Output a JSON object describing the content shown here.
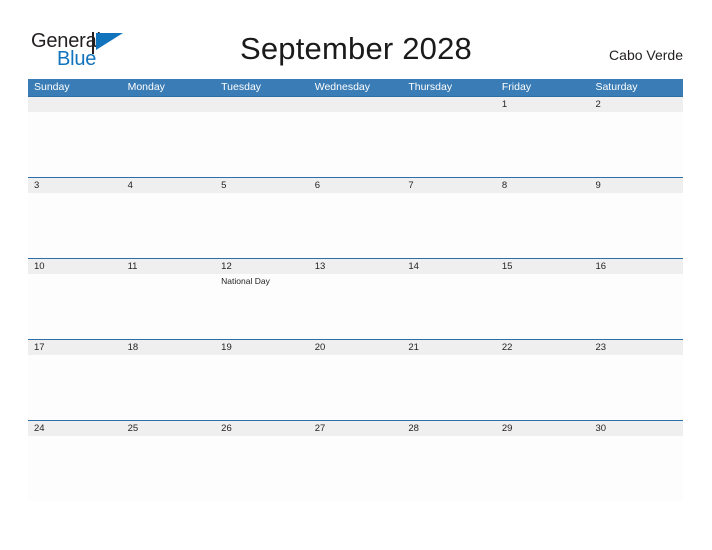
{
  "logo": {
    "text_top": "General",
    "text_bottom": "Blue",
    "flag_icon": "blue-flag-triangle-icon",
    "accent_color": "#1273bd"
  },
  "header": {
    "title": "September 2028",
    "country": "Cabo Verde"
  },
  "theme": {
    "header_blue": "#3a7cb5",
    "rule_blue": "#2f6fa8",
    "date_band_gray": "#efefef",
    "cell_white": "#fdfdfd",
    "text_dark": "#231f20"
  },
  "calendar": {
    "weekdays": [
      "Sunday",
      "Monday",
      "Tuesday",
      "Wednesday",
      "Thursday",
      "Friday",
      "Saturday"
    ],
    "weeks": [
      {
        "days": [
          {
            "date": "",
            "event": ""
          },
          {
            "date": "",
            "event": ""
          },
          {
            "date": "",
            "event": ""
          },
          {
            "date": "",
            "event": ""
          },
          {
            "date": "",
            "event": ""
          },
          {
            "date": "1",
            "event": ""
          },
          {
            "date": "2",
            "event": ""
          }
        ]
      },
      {
        "days": [
          {
            "date": "3",
            "event": ""
          },
          {
            "date": "4",
            "event": ""
          },
          {
            "date": "5",
            "event": ""
          },
          {
            "date": "6",
            "event": ""
          },
          {
            "date": "7",
            "event": ""
          },
          {
            "date": "8",
            "event": ""
          },
          {
            "date": "9",
            "event": ""
          }
        ]
      },
      {
        "days": [
          {
            "date": "10",
            "event": ""
          },
          {
            "date": "11",
            "event": ""
          },
          {
            "date": "12",
            "event": "National Day"
          },
          {
            "date": "13",
            "event": ""
          },
          {
            "date": "14",
            "event": ""
          },
          {
            "date": "15",
            "event": ""
          },
          {
            "date": "16",
            "event": ""
          }
        ]
      },
      {
        "days": [
          {
            "date": "17",
            "event": ""
          },
          {
            "date": "18",
            "event": ""
          },
          {
            "date": "19",
            "event": ""
          },
          {
            "date": "20",
            "event": ""
          },
          {
            "date": "21",
            "event": ""
          },
          {
            "date": "22",
            "event": ""
          },
          {
            "date": "23",
            "event": ""
          }
        ]
      },
      {
        "days": [
          {
            "date": "24",
            "event": ""
          },
          {
            "date": "25",
            "event": ""
          },
          {
            "date": "26",
            "event": ""
          },
          {
            "date": "27",
            "event": ""
          },
          {
            "date": "28",
            "event": ""
          },
          {
            "date": "29",
            "event": ""
          },
          {
            "date": "30",
            "event": ""
          }
        ]
      }
    ]
  }
}
